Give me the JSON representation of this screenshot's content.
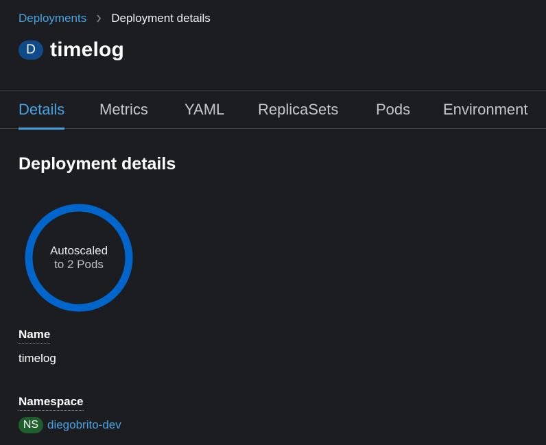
{
  "breadcrumb": {
    "parent": "Deployments",
    "current": "Deployment details"
  },
  "header": {
    "badge": "D",
    "title": "timelog"
  },
  "tabs": [
    {
      "label": "Details",
      "active": true
    },
    {
      "label": "Metrics"
    },
    {
      "label": "YAML"
    },
    {
      "label": "ReplicaSets"
    },
    {
      "label": "Pods"
    },
    {
      "label": "Environment"
    }
  ],
  "section": {
    "title": "Deployment details"
  },
  "pod_ring": {
    "line1": "Autoscaled",
    "line2": "to 2 Pods",
    "color": "#0066cc"
  },
  "fields": {
    "name_label": "Name",
    "name_value": "timelog",
    "namespace_label": "Namespace",
    "namespace_badge": "NS",
    "namespace_value": "diegobrito-dev"
  },
  "colors": {
    "background": "#1b1d21",
    "link": "#4aa4e3",
    "deployment_badge": "#0f4a8a",
    "namespace_badge": "#1f5e2d"
  }
}
